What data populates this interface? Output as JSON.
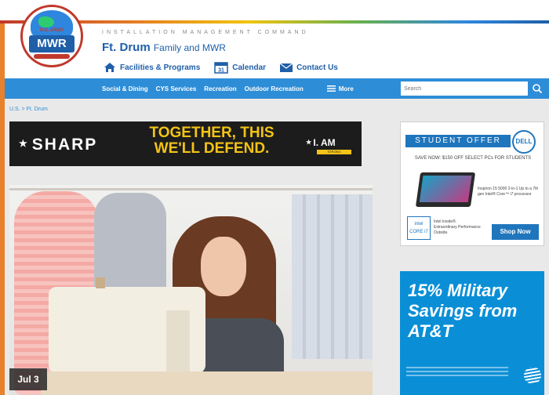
{
  "header": {
    "org_line": "INSTALLATION MANAGEMENT COMMAND",
    "site_title_bold": "Ft. Drum",
    "site_title_rest": "Family and MWR",
    "logo_text": "MWR",
    "logo_small": "U.S. ARMY",
    "quick_links": {
      "facilities": "Facilities & Programs",
      "calendar": "Calendar",
      "calendar_day": "31",
      "contact": "Contact Us"
    }
  },
  "nav": {
    "items": [
      "Social & Dining",
      "CYS Services",
      "Recreation",
      "Outdoor Recreation"
    ],
    "more": "More",
    "search_placeholder": "Search"
  },
  "breadcrumb": "U.S. > Ft. Drum",
  "sharp_banner": {
    "logo": "SHARP",
    "slogan": "TOGETHER, THIS WE'LL DEFEND.",
    "iam": "I. AM",
    "iam_sub": "STRONG"
  },
  "hero": {
    "date_badge": "Jul 3"
  },
  "dell_ad": {
    "badge": "STUDENT OFFER",
    "brand": "DELL",
    "save_text": "SAVE NOW: $150 OFF SELECT PCs FOR STUDENTS",
    "product_desc": "Inspiron 15 5000 2-in-1 Up to a 7th gen Intel® Core™ i7 processor",
    "intel_badge": "intel CORE i7",
    "intel_text": "Intel Inside®. Extraordinary Performance Outside.",
    "cta": "Shop Now"
  },
  "att_ad": {
    "headline": "15% Military Savings from AT&T"
  },
  "colors": {
    "brand_blue": "#1f5fa8",
    "nav_blue": "#2e8dd7",
    "accent_orange": "#e8812b",
    "sharp_yellow": "#f3c316",
    "att_blue": "#0a8fd6"
  }
}
